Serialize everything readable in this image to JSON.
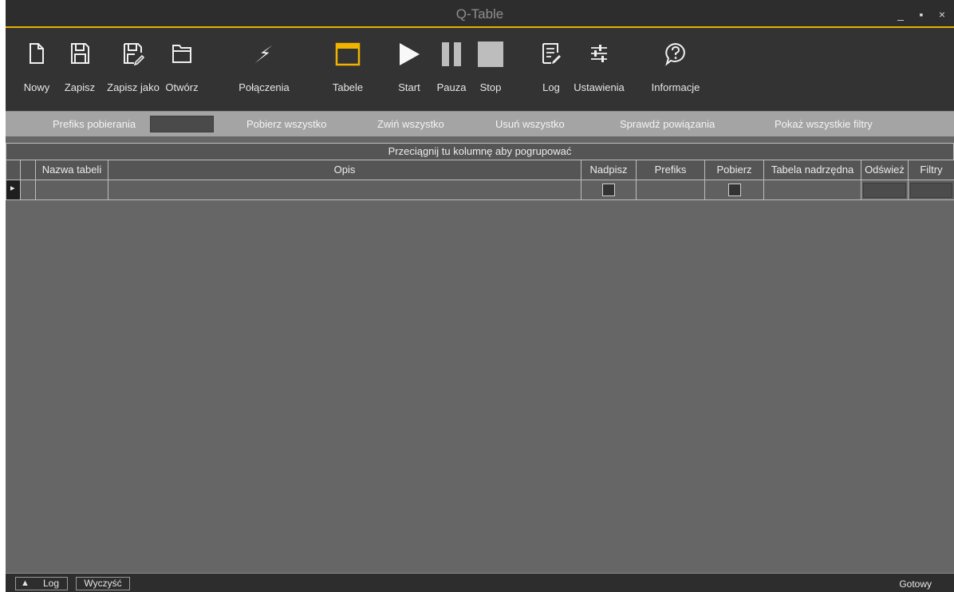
{
  "window": {
    "title": "Q-Table",
    "controls": {
      "minimize": "_",
      "maximize": "▪",
      "close": "×"
    },
    "accent_color": "#e2b200"
  },
  "toolbar": {
    "new_label": "Nowy",
    "save_label": "Zapisz",
    "save_as_label": "Zapisz jako",
    "open_label": "Otwórz",
    "connections_label": "Połączenia",
    "tables_label": "Tabele",
    "start_label": "Start",
    "pause_label": "Pauza",
    "stop_label": "Stop",
    "log_label": "Log",
    "settings_label": "Ustawienia",
    "info_label": "Informacje",
    "icons": [
      "new-file-icon",
      "save-icon",
      "save-as-icon",
      "open-folder-icon",
      "lightning-icon",
      "table-icon",
      "play-icon",
      "pause-icon",
      "stop-icon",
      "log-icon",
      "sliders-icon",
      "help-bubble-icon"
    ]
  },
  "filterbar": {
    "prefix_label": "Prefiks pobierania",
    "prefix_value": "",
    "fetch_all": "Pobierz wszystko",
    "collapse_all": "Zwiń wszystko",
    "delete_all": "Usuń wszystko",
    "check_relations": "Sprawdź powiązania",
    "show_all_filters": "Pokaż wszystkie filtry"
  },
  "grid": {
    "group_hint": "Przeciągnij tu kolumnę aby pogrupować",
    "columns": [
      "Nazwa tabeli",
      "Opis",
      "Nadpisz",
      "Prefiks",
      "Pobierz",
      "Tabela nadrzędna",
      "Odśwież",
      "Filtry"
    ],
    "row_indicator": "▸",
    "rows": [
      {
        "table_name": "",
        "description": "",
        "overwrite": false,
        "prefix": "",
        "fetch": false,
        "parent_table": "",
        "refresh": "",
        "filters": ""
      }
    ]
  },
  "statusbar": {
    "log_toggle_icon": "▲",
    "log_label": "Log",
    "clear_label": "Wyczyść",
    "status_text": "Gotowy"
  }
}
